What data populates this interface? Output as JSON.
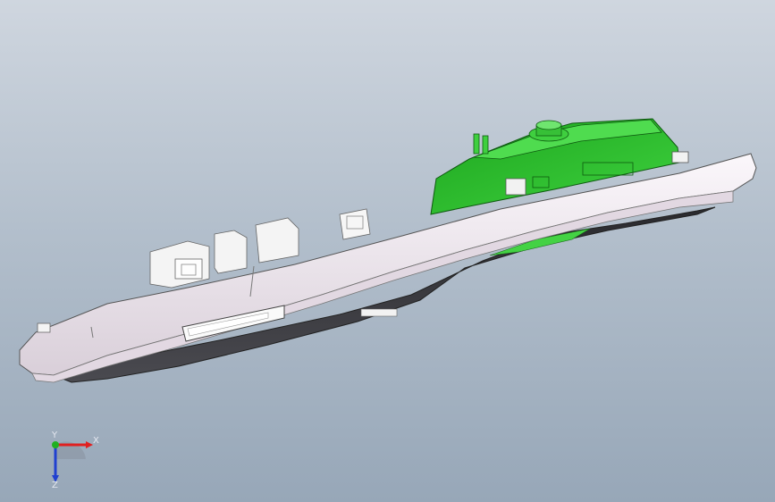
{
  "viewport": {
    "background_top": "#cfd6df",
    "background_bottom": "#97a7b8"
  },
  "model": {
    "shell_color": "#f1eaf1",
    "underside_color": "#3a3a3e",
    "pcb_color": "#2fbf32",
    "connector_color": "#f2f2f2"
  },
  "triad": {
    "x_label": "X",
    "y_label": "Y",
    "z_label": "Z",
    "x_color": "#e02020",
    "y_color": "#20b020",
    "z_color": "#2040d0"
  }
}
